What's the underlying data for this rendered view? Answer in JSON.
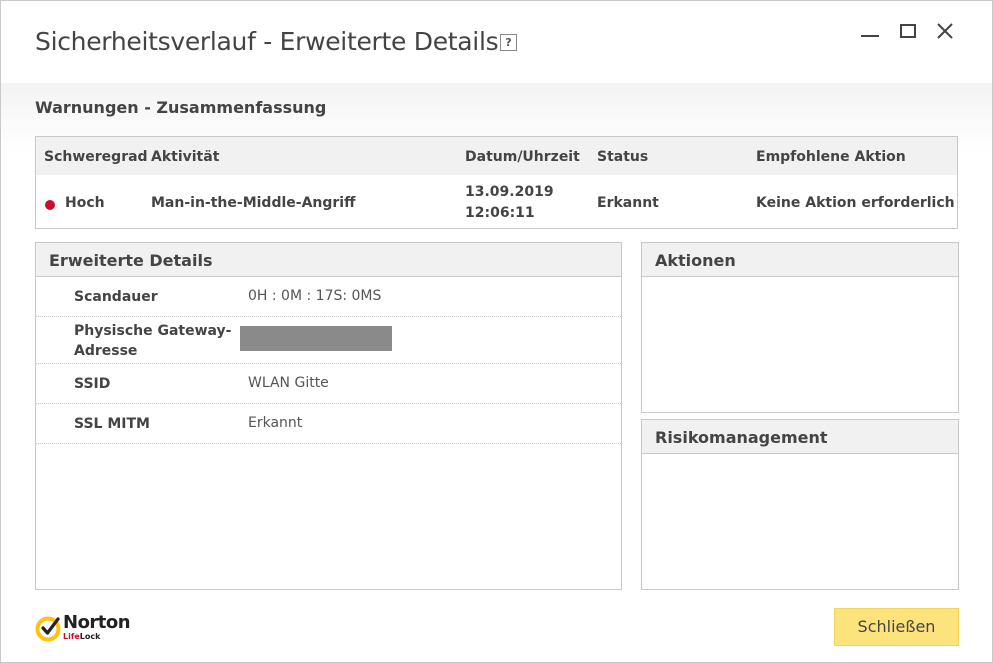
{
  "window": {
    "title": "Sicherheitsverlauf - Erweiterte Details",
    "help_glyph": "?"
  },
  "summary": {
    "title": "Warnungen - Zusammenfassung",
    "columns": [
      "Schweregrad",
      "Aktivität",
      "Datum/Uhrzeit",
      "Status",
      "Empfohlene Aktion"
    ],
    "row": {
      "severity": "Hoch",
      "severity_color": "#c8102e",
      "activity": "Man-in-the-Middle-Angriff",
      "date": "13.09.2019",
      "time": "12:06:11",
      "status": "Erkannt",
      "recommended_action": "Keine Aktion erforderlich"
    }
  },
  "details": {
    "title": "Erweiterte Details",
    "rows": [
      {
        "label": "Scandauer",
        "value": "0H : 0M : 17S: 0MS"
      },
      {
        "label": "Physische Gateway-Adresse",
        "label_line1": "Physische Gateway-",
        "label_line2": "Adresse",
        "value": ""
      },
      {
        "label": "SSID",
        "value": "WLAN Gitte"
      },
      {
        "label": "SSL MITM",
        "value": "Erkannt"
      }
    ]
  },
  "actions_panel": {
    "title": "Aktionen"
  },
  "risk_panel": {
    "title": "Risikomanagement"
  },
  "logo": {
    "brand": "Norton",
    "sub_prefix": "Life",
    "sub_suffix": "Lock",
    "badge_color": "#ffc20e"
  },
  "footer": {
    "close_label": "Schließen",
    "close_color": "#fde37c"
  }
}
